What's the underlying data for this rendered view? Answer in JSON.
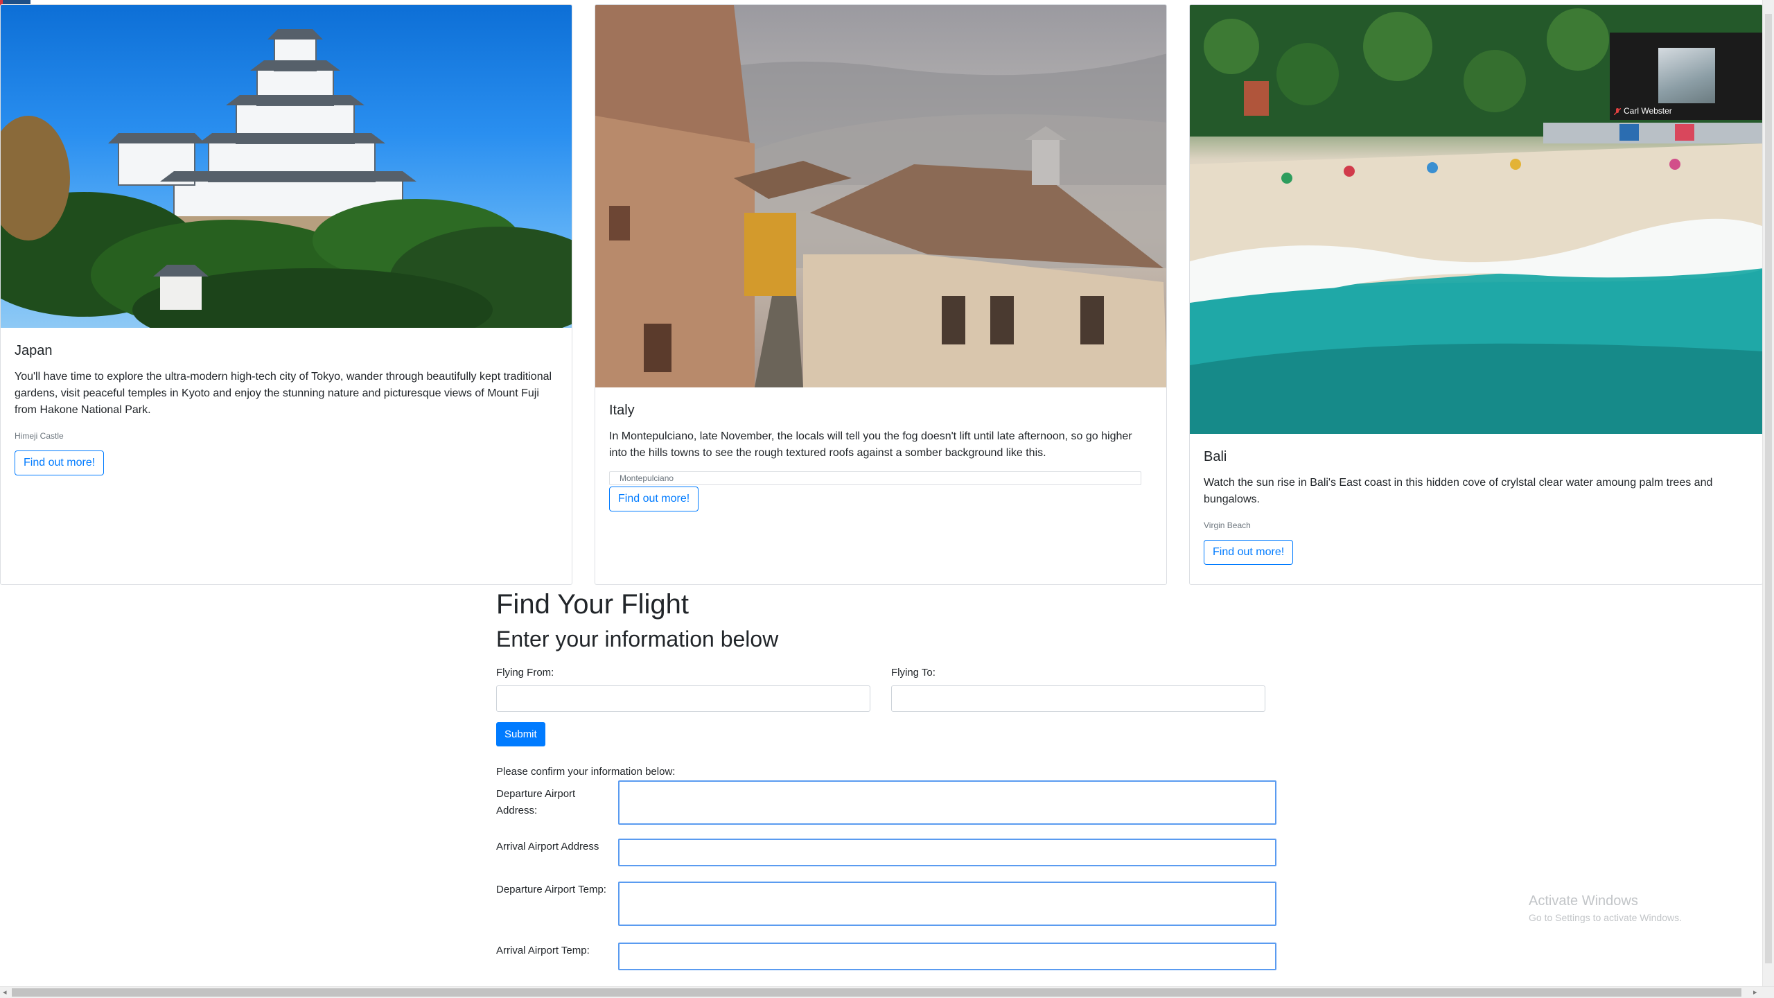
{
  "cards": [
    {
      "title": "Japan",
      "text": "You'll have time to explore the ultra-modern high-tech city of Tokyo, wander through beautifully kept traditional gardens, visit peaceful temples in Kyoto and enjoy the stunning nature and picturesque views of Mount Fuji from Hakone National Park.",
      "caption": "Himeji Castle",
      "button": "Find out more!"
    },
    {
      "title": "Italy",
      "text": "In Montepulciano, late November, the locals will tell you the fog doesn't lift until late afternoon, so go higher into the hills towns to see the rough textured roofs against a somber background like this.",
      "caption": "Montepulciano",
      "button": "Find out more!"
    },
    {
      "title": "Bali",
      "text": "Watch the sun rise in Bali's East coast in this hidden cove of crylstal clear water amoung palm trees and bungalows.",
      "caption": "Virgin Beach",
      "button": "Find out more!"
    }
  ],
  "video": {
    "name": "Carl Webster"
  },
  "form": {
    "title": "Find Your Flight",
    "subtitle": "Enter your information below",
    "from_label": "Flying From:",
    "to_label": "Flying To:",
    "from_value": "",
    "to_value": "",
    "submit": "Submit",
    "confirm_text": "Please confirm your information below:",
    "confirm_fields": [
      {
        "label": "Departure Airport Address:",
        "value": ""
      },
      {
        "label": "Arrival Airport Address",
        "value": ""
      },
      {
        "label": "Departure Airport Temp:",
        "value": ""
      },
      {
        "label": "Arrival Airport Temp:",
        "value": ""
      }
    ]
  },
  "watermark": {
    "line1": "Activate Windows",
    "line2": "Go to Settings to activate Windows."
  },
  "icons": [
    "microphone-icon",
    "mic-muted-icon"
  ],
  "colors": {
    "primary": "#007bff",
    "mic_bg": "#1f4f86",
    "focus_border": "#5a9bf0"
  }
}
